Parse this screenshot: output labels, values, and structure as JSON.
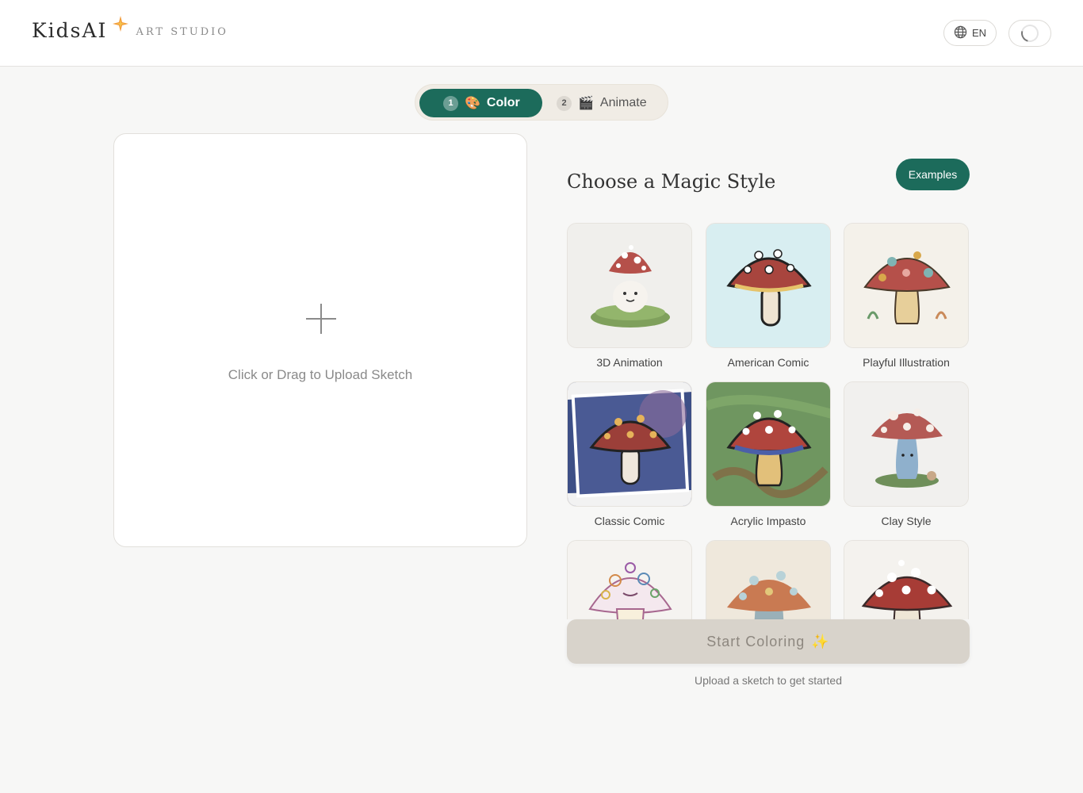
{
  "header": {
    "logo_main": "KidsAI",
    "logo_sub": "ART STUDIO",
    "lang_label": "EN"
  },
  "stepper": {
    "steps": [
      {
        "num": "1",
        "icon": "🎨",
        "label": "Color"
      },
      {
        "num": "2",
        "icon": "🎬",
        "label": "Animate"
      }
    ]
  },
  "upload": {
    "label": "Click or Drag to Upload Sketch"
  },
  "styles": {
    "title": "Choose a Magic Style",
    "examples_label": "Examples",
    "items": [
      {
        "label": "3D Animation"
      },
      {
        "label": "American Comic"
      },
      {
        "label": "Playful Illustration"
      },
      {
        "label": "Classic Comic"
      },
      {
        "label": "Acrylic Impasto"
      },
      {
        "label": "Clay Style"
      },
      {
        "label": ""
      },
      {
        "label": ""
      },
      {
        "label": ""
      }
    ]
  },
  "actions": {
    "start_label": "Start Coloring",
    "start_icon": "✨",
    "hint": "Upload a sketch to get started"
  },
  "colors": {
    "accent": "#1c6b5b",
    "disabled_button": "#d8d3cb",
    "mushroom_cap": "#b5504a"
  }
}
